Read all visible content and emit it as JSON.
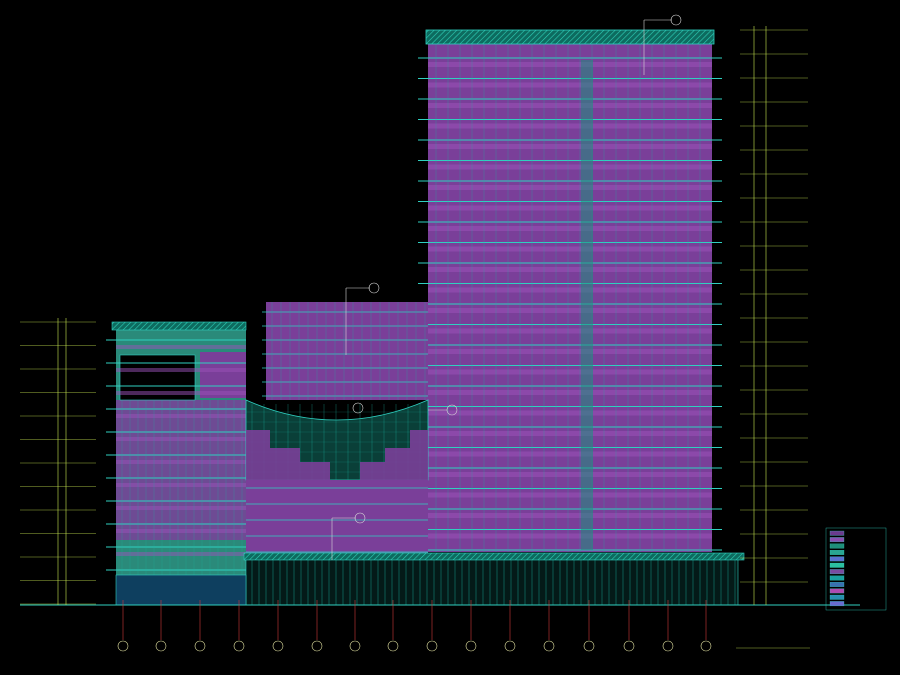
{
  "drawing": {
    "title_block": {
      "title": "",
      "scale": ""
    },
    "grid_axes": {
      "labels": [
        "",
        "",
        "",
        "",
        "",
        "",
        "",
        "",
        "",
        "",
        "",
        "",
        "",
        "",
        "",
        ""
      ]
    },
    "elevation_callouts": [
      "",
      "",
      ""
    ],
    "left_level_marks": [
      "",
      "",
      "",
      "",
      "",
      "",
      "",
      "",
      "",
      "",
      "",
      ""
    ],
    "right_level_marks": [
      "",
      "",
      "",
      "",
      "",
      "",
      "",
      "",
      "",
      "",
      "",
      "",
      "",
      "",
      "",
      "",
      "",
      "",
      "",
      "",
      "",
      "",
      "",
      ""
    ],
    "legend": {
      "items": [
        "",
        "",
        "",
        "",
        "",
        "",
        "",
        "",
        "",
        "",
        "",
        ""
      ],
      "swatch_colors": [
        "#6b3a8e",
        "#8a4fb0",
        "#1f8f7a",
        "#2aa592",
        "#5a6fd0",
        "#2bc0a0",
        "#7a4aa0",
        "#1aa0a0",
        "#3a6fb0",
        "#b04ab0",
        "#2a8fb0",
        "#6a6ad0"
      ],
      "notes": [
        "",
        "",
        ""
      ]
    },
    "colors": {
      "background": "#000000",
      "facade_glass": "#7a3f99",
      "mullion": "#19b3a0",
      "slab_line": "#2fd0c0",
      "roof_hatch": "#15a38e",
      "dimension": "#c8e850",
      "grid_line": "#d03a3a",
      "grid_bubble": "#e0e0a0"
    }
  }
}
